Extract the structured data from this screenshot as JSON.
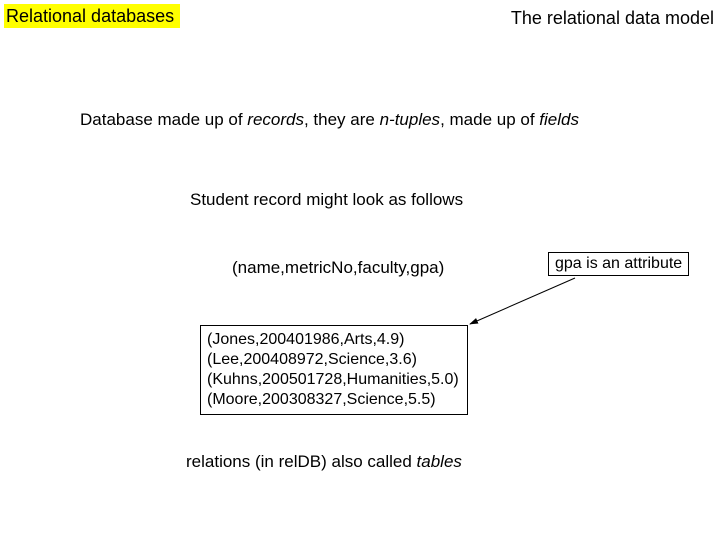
{
  "header": {
    "left": "Relational databases",
    "right": "The relational data model"
  },
  "body": {
    "intro_prefix": "Database made up of ",
    "intro_records": "records",
    "intro_mid1": ", they are ",
    "intro_ntuples": "n-tuples",
    "intro_mid2": ", made up of ",
    "intro_fields": "fields",
    "student_line": "Student record might look as follows",
    "tuple_schema": "(name,metricNo,faculty,gpa)",
    "attr_note": "gpa is an attribute",
    "records": [
      "(Jones,200401986,Arts,4.9)",
      "(Lee,200408972,Science,3.6)",
      "(Kuhns,200501728,Humanities,5.0)",
      "(Moore,200308327,Science,5.5)"
    ],
    "footer_prefix": "relations  (in relDB) also called ",
    "footer_tables": "tables"
  }
}
